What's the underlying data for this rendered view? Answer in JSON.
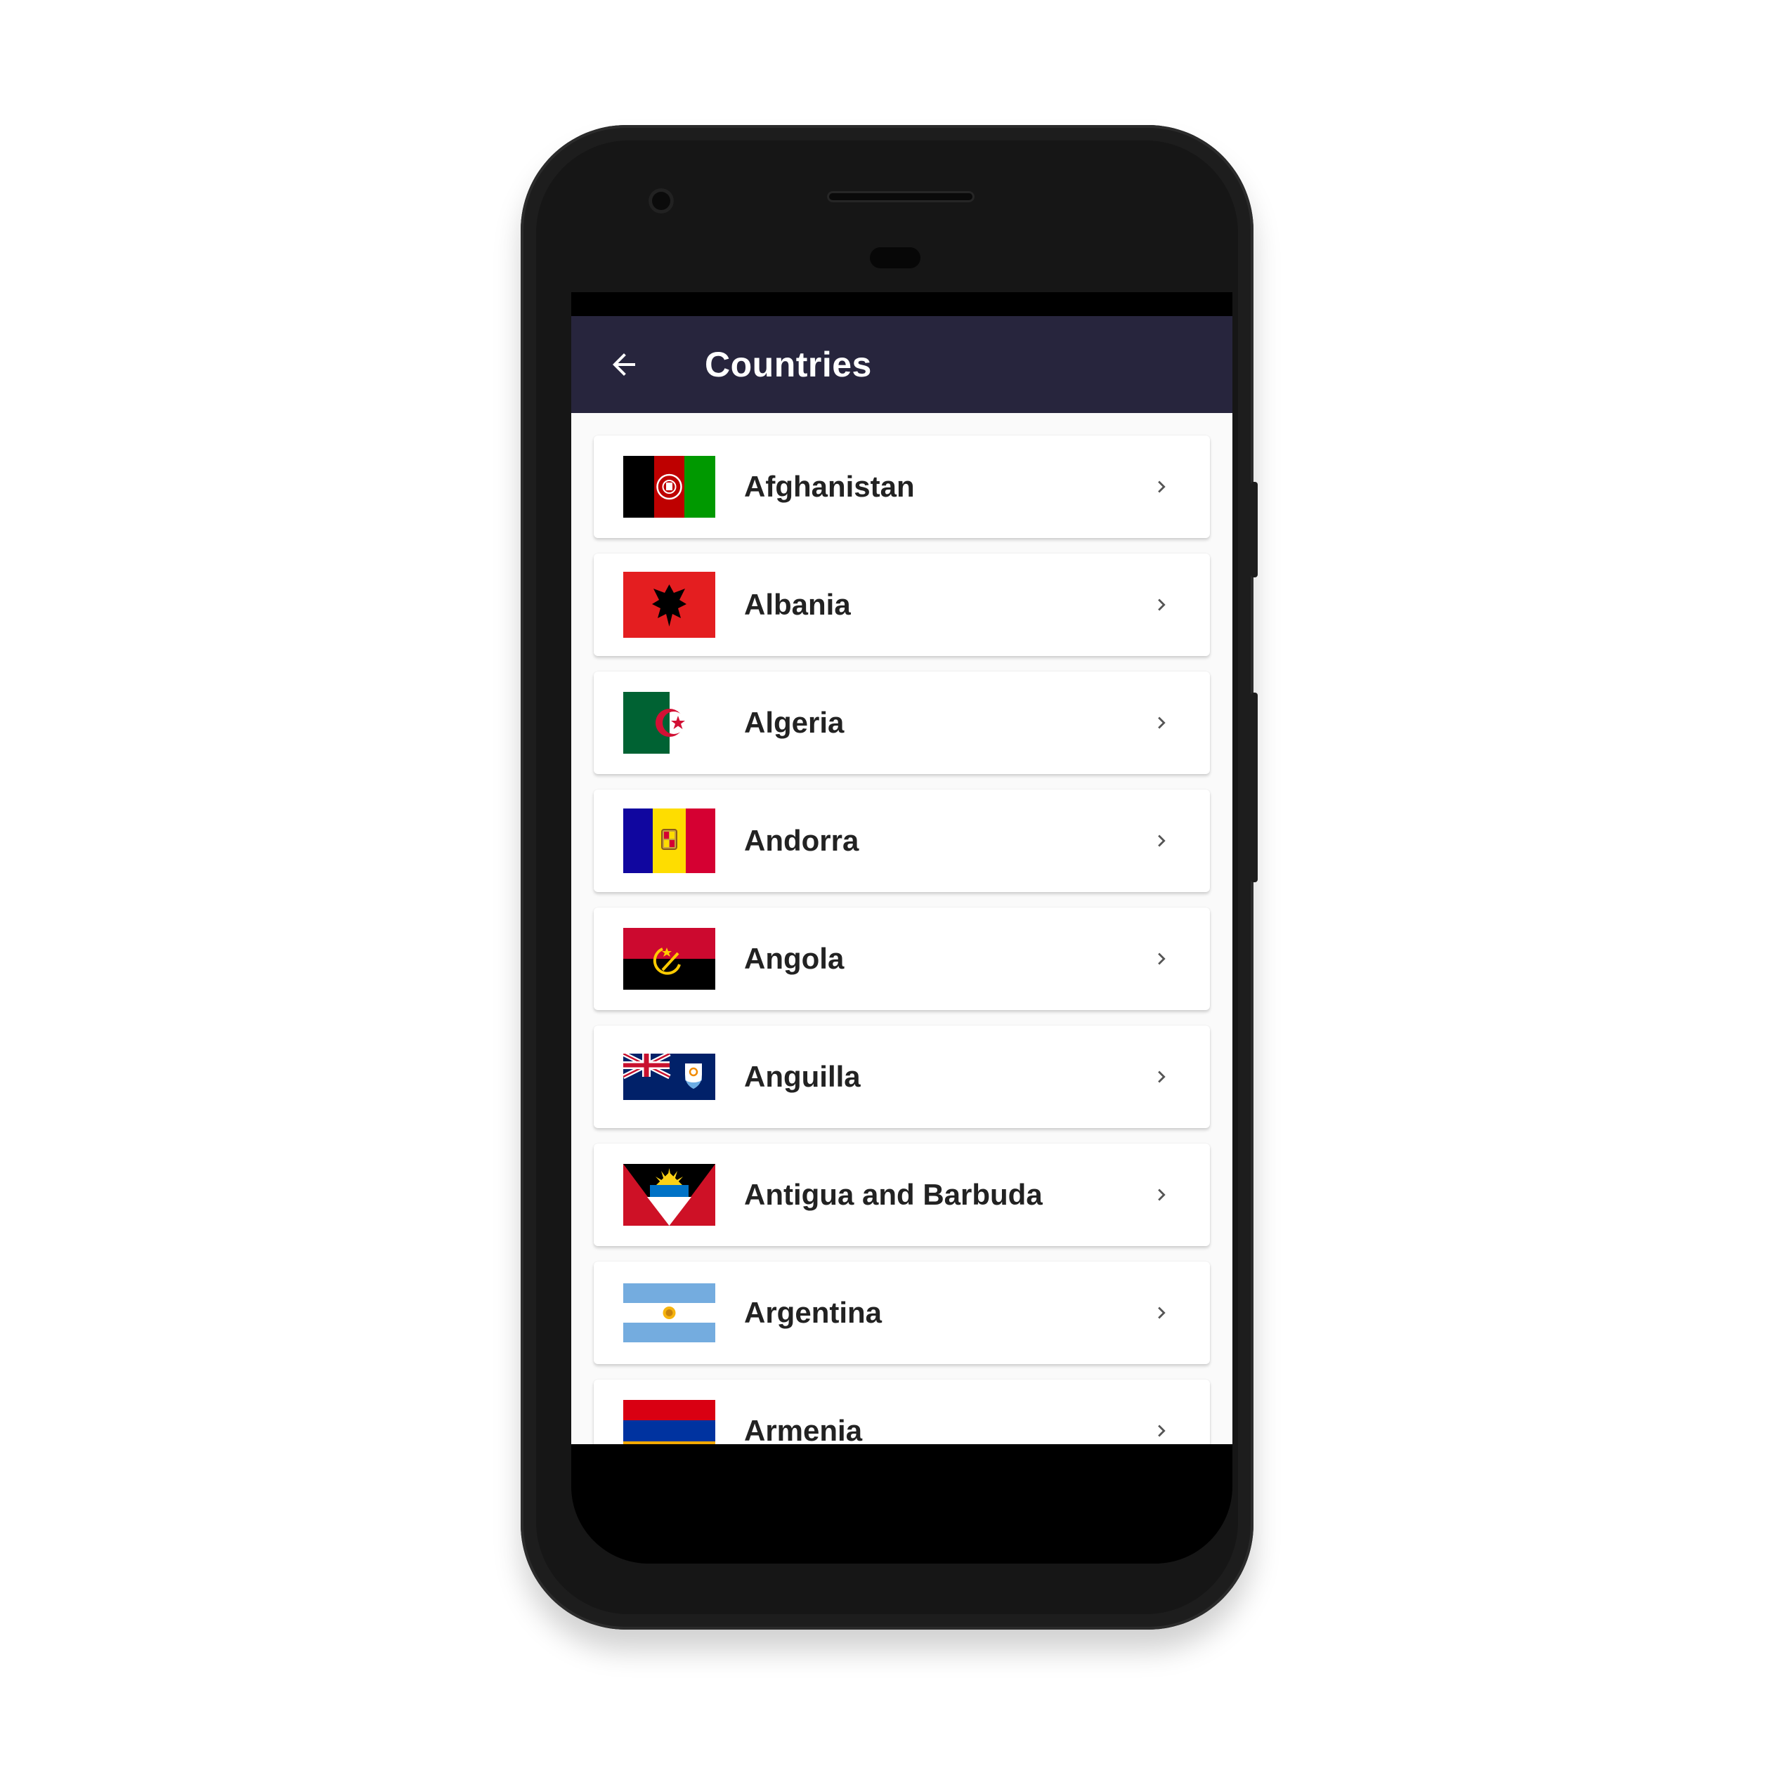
{
  "appbar": {
    "title": "Countries",
    "back_icon": "arrow-left-icon",
    "background": "#27253d"
  },
  "list": {
    "chevron_icon": "chevron-right-icon",
    "items": [
      {
        "label": "Afghanistan",
        "flag": "flag-afghanistan-icon"
      },
      {
        "label": "Albania",
        "flag": "flag-albania-icon"
      },
      {
        "label": "Algeria",
        "flag": "flag-algeria-icon"
      },
      {
        "label": "Andorra",
        "flag": "flag-andorra-icon"
      },
      {
        "label": "Angola",
        "flag": "flag-angola-icon"
      },
      {
        "label": "Anguilla",
        "flag": "flag-anguilla-icon"
      },
      {
        "label": "Antigua and Barbuda",
        "flag": "flag-antigua-and-barbuda-icon"
      },
      {
        "label": "Argentina",
        "flag": "flag-argentina-icon"
      },
      {
        "label": "Armenia",
        "flag": "flag-armenia-icon"
      }
    ]
  }
}
